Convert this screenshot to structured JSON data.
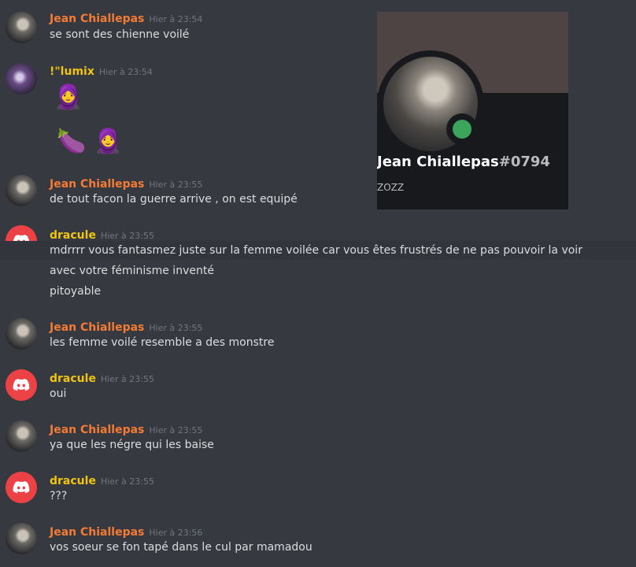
{
  "colors": {
    "background": "#36393f",
    "name_orange": "#f47b35",
    "name_yellow": "#f1c40f",
    "text": "#dcddde",
    "timestamp": "#72767d",
    "discord_red": "#ed4245",
    "online": "#3ba55c"
  },
  "messages": [
    {
      "author": "Jean Chiallepas",
      "time": "Hier à 23:54",
      "lines": [
        "se sont des chienne  voilé"
      ],
      "avatar": "photo"
    },
    {
      "author": "!\"lumix",
      "time": "Hier à 23:54",
      "emoji": [
        "🧕",
        "🍆 🧕"
      ],
      "avatar": "photo2"
    },
    {
      "author": "Jean Chiallepas",
      "time": "Hier à 23:55",
      "lines": [
        "de tout facon la guerre arrive , on est equipé"
      ],
      "avatar": "photo"
    },
    {
      "author": "dracule",
      "time": "Hier à 23:55",
      "lines": [
        "mdrrrr vous fantasmez juste sur la femme voilée car vous êtes frustrés de ne pas pouvoir la voir",
        "avec votre féminisme inventé",
        "pitoyable"
      ],
      "avatar": "discord"
    },
    {
      "author": "Jean Chiallepas",
      "time": "Hier à 23:55",
      "lines": [
        "les femme  voilé resemble a des monstre"
      ],
      "avatar": "photo"
    },
    {
      "author": "dracule",
      "time": "Hier à 23:55",
      "lines": [
        "oui"
      ],
      "avatar": "discord"
    },
    {
      "author": "Jean Chiallepas",
      "time": "Hier à 23:55",
      "lines": [
        "ya que les négre qui les baise"
      ],
      "avatar": "photo"
    },
    {
      "author": "dracule",
      "time": "Hier à 23:55",
      "lines": [
        "???"
      ],
      "avatar": "discord"
    },
    {
      "author": "Jean Chiallepas",
      "time": "Hier à 23:56",
      "lines": [
        "vos soeur se fon tapé dans le cul par mamadou"
      ],
      "avatar": "photo"
    }
  ],
  "profile_popout": {
    "username": "Jean Chiallepas",
    "discriminator": "#0794",
    "note": "ZOZZ",
    "status": "online"
  }
}
